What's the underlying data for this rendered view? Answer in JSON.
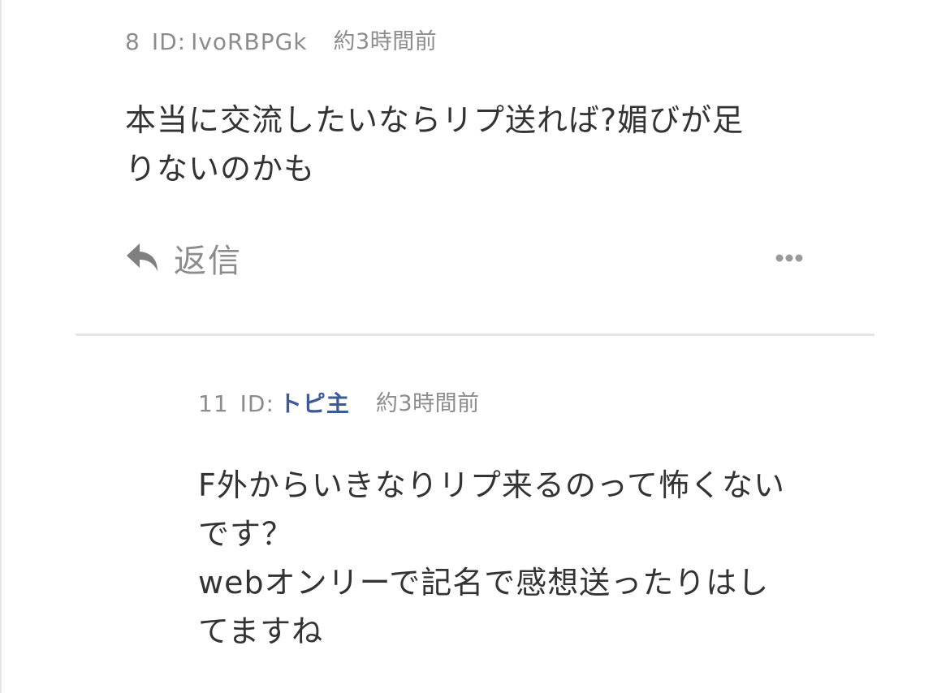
{
  "comments": [
    {
      "number": "8",
      "id_label": "ID:",
      "id_value": "IvoRBPGk",
      "time": "約3時間前",
      "body_lines": [
        "本当に交流したいならリプ送れば?媚びが足",
        "りないのかも"
      ],
      "reply_label": "返信",
      "reply_icon": "reply-arrow-icon",
      "more_icon": "ellipsis-icon"
    },
    {
      "number": "11",
      "id_label": "ID:",
      "id_value": "トピ主",
      "time": "約3時間前",
      "body_lines": [
        "F外からいきなりリプ来るのって怖くない",
        "です？",
        "webオンリーで記名で感想送ったりはし",
        "てますね"
      ]
    }
  ],
  "colors": {
    "meta_text": "#8c8c8c",
    "body_text": "#333333",
    "op_id": "#3e5a98",
    "divider": "#e5e5e5"
  }
}
